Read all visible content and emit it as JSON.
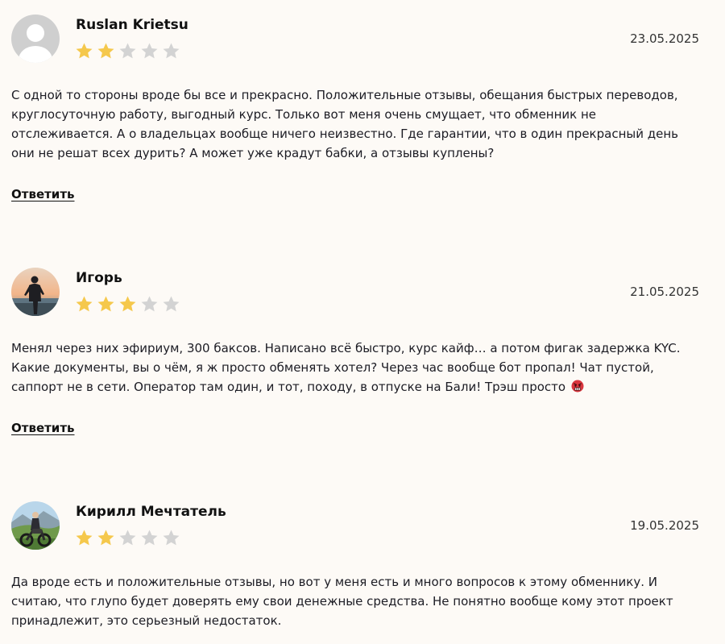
{
  "reviews": [
    {
      "author": "Ruslan Krietsu",
      "rating": 2,
      "max_rating": 5,
      "date": "23.05.2025",
      "avatar": "default-user-avatar",
      "text": "С одной то стороны вроде бы все и прекрасно. Положительные отзывы, обещания быстрых переводов, круглосуточную работу, выгодный курс. Только вот меня очень смущает, что обменник не отслеживается. А о владельцах вообще ничего неизвестно. Где гарантии, что в один прекрасный день они не решат всех дурить? А может уже крадут бабки, а отзывы куплены?",
      "reply_label": "Ответить"
    },
    {
      "author": "Игорь",
      "rating": 3,
      "max_rating": 5,
      "date": "21.05.2025",
      "avatar": "photo-man-sunset",
      "text": "Менял через них эфириум, 300 баксов. Написано всё быстро, курс кайф… а потом фигак задержка KYC. Какие документы, вы о чём, я ж просто обменять хотел? Через час вообще бот пропал! Чат пустой, саппорт не в сети. Оператор там один, и тот, походу, в отпуске на Бали! Трэш просто",
      "text_emoji": "angry-face-emoji",
      "reply_label": "Ответить"
    },
    {
      "author": "Кирилл Мечтатель",
      "rating": 2,
      "max_rating": 5,
      "date": "19.05.2025",
      "avatar": "photo-motorcycle-mountains",
      "text": "Да вроде есть и положительные отзывы, но вот у меня есть и много вопросов к этому обменнику. И считаю, что глупо будет доверять ему свои денежные средства. Не понятно вообще кому этот проект принадлежит, это серьезный недостаток."
    }
  ],
  "colors": {
    "background": "#fdfaf6",
    "star_filled": "#f5c84c",
    "star_empty": "#d3d3d3",
    "text": "#1c1c24"
  }
}
